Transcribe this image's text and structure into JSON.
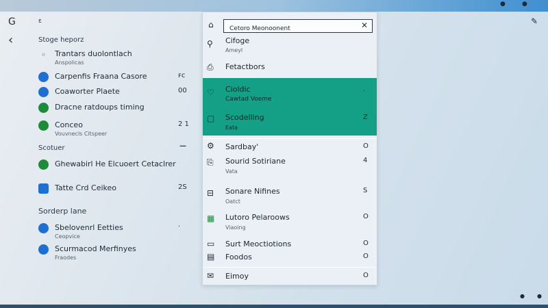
{
  "window": {
    "dots": [
      "●",
      "●"
    ]
  },
  "left": {
    "logo_glyph": "G",
    "back_glyph": "‹",
    "header_small": "ε",
    "section1": "Stoge heporz",
    "items1": [
      {
        "title": "Trantars duolontlach",
        "sub": "Anspolicas",
        "value": "",
        "icon": "ring-icon",
        "glyph": "◦",
        "color": "plain"
      },
      {
        "title": "Carpenfis Fraana Casore",
        "sub": "",
        "value": "ꜰc",
        "icon": "blue-circle-icon",
        "glyph": "●",
        "color": "blue"
      },
      {
        "title": "Coaworter Plaete",
        "sub": "",
        "value": "00",
        "icon": "blue-circle-icon",
        "glyph": "●",
        "color": "blue"
      },
      {
        "title": "Dracne ratdoups timing",
        "sub": "",
        "value": "",
        "icon": "green-circle-icon",
        "glyph": "●",
        "color": "green"
      },
      {
        "title": "Conceo",
        "sub": "Vouvnecls Citspeer",
        "value": "2 1",
        "icon": "green-circle-icon",
        "glyph": "●",
        "color": "green"
      }
    ],
    "section2": "Scotuer",
    "section2_value": "—",
    "items2": [
      {
        "title": "Ghewabirl He Elcuoert Cetaclrer",
        "sub": "",
        "value": "",
        "icon": "green-circle-icon",
        "glyph": "●",
        "color": "green"
      },
      {
        "title": "Tatte Crd Ceikeo",
        "sub": "",
        "value": "2S",
        "icon": "blue-square-icon",
        "glyph": "▣",
        "color": "blue"
      }
    ],
    "section3": "Sorderp lane",
    "items3": [
      {
        "title": "Sbelovenrl Eetties",
        "sub": "Ceopvice",
        "value": "·",
        "icon": "blue-circle-icon",
        "glyph": "●",
        "color": "blue"
      },
      {
        "title": "Scurmacod Merfinyes",
        "sub": "Fraodes",
        "value": "",
        "icon": "blue-circle-icon",
        "glyph": "●",
        "color": "blue"
      }
    ]
  },
  "panel": {
    "search_value": "Cetoro Meonoonent",
    "top_icon_glyph": "⌂",
    "close_glyph": "✕",
    "rows": [
      {
        "title": "Cifoge",
        "sub": "Ameyl",
        "value": "",
        "icon": "pin-icon",
        "glyph": "⚲"
      },
      {
        "title": "Fetactbors",
        "sub": "",
        "value": "",
        "icon": "bag-icon",
        "glyph": "⎙"
      }
    ],
    "highlighted": [
      {
        "title": "Cioldic",
        "sub": "Cawtad Voeme",
        "value": "·",
        "icon": "heart-icon",
        "glyph": "♡"
      },
      {
        "title": "Scodelling",
        "sub": "Eata",
        "value": "Z",
        "icon": "square-icon",
        "glyph": "▢"
      }
    ],
    "rows2": [
      {
        "title": "Sardbay'",
        "sub": "",
        "value": "O",
        "icon": "settings-icon",
        "glyph": "⚙"
      },
      {
        "title": "Sourid Sotiriane",
        "sub": "Vata",
        "value": "4",
        "icon": "file-icon",
        "glyph": "⎘"
      },
      {
        "title": "Sonare Nifines",
        "sub": "Oatct",
        "value": "S",
        "icon": "document-icon",
        "glyph": "⊟"
      },
      {
        "title": "Lutoro Pelaroows",
        "sub": "Viaoing",
        "value": "O",
        "icon": "green-square-icon",
        "glyph": "▦"
      },
      {
        "title": "Surt Meoctiotions",
        "sub": "",
        "value": "O",
        "icon": "screen-icon",
        "glyph": "▭"
      },
      {
        "title": "Foodos",
        "sub": "",
        "value": "O",
        "icon": "box-icon",
        "glyph": "▤"
      },
      {
        "title": "Eimoy",
        "sub": "",
        "value": "O",
        "icon": "mail-icon",
        "glyph": "✉"
      }
    ]
  },
  "right": {
    "edit_glyph": "✎",
    "tray_glyphs": [
      "●",
      "●"
    ]
  }
}
